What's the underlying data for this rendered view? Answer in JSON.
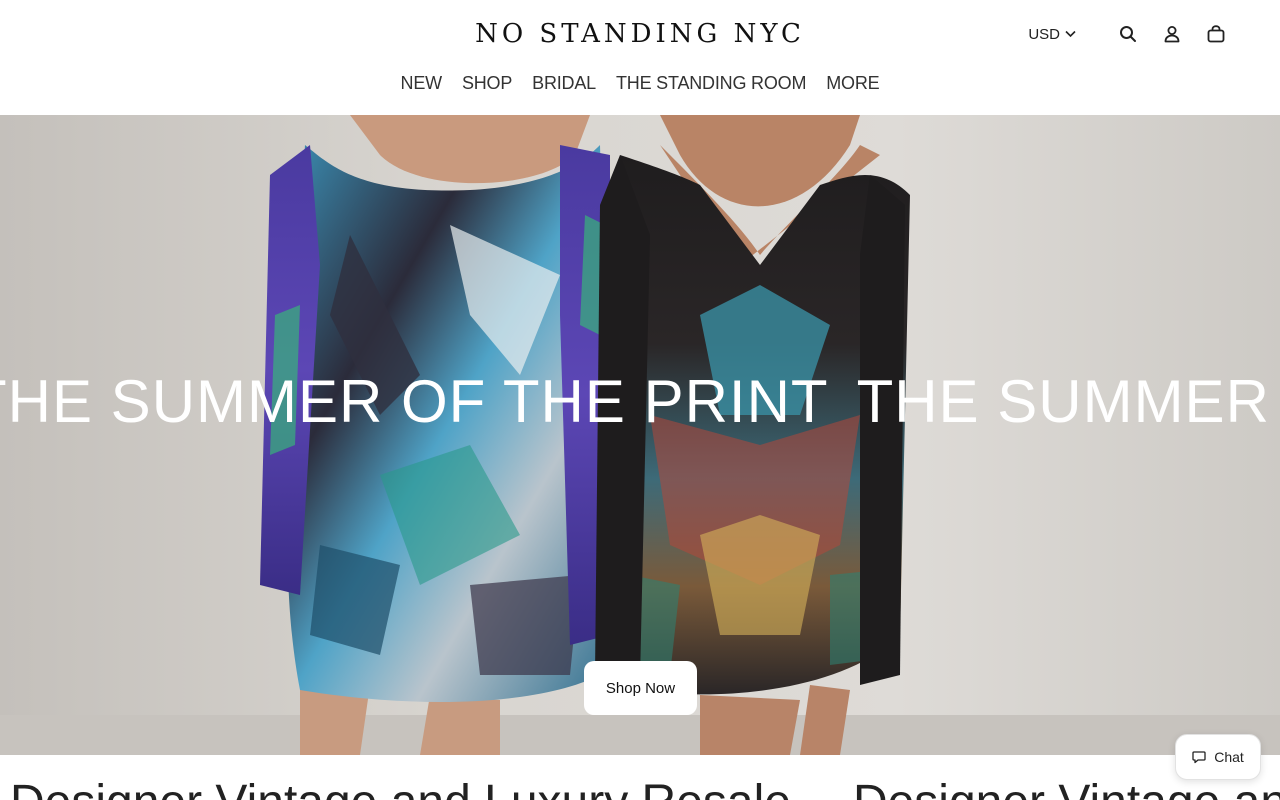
{
  "header": {
    "logo_text": "NO STANDING NYC",
    "currency": "USD",
    "icons": [
      "search-icon",
      "account-icon",
      "bag-icon"
    ]
  },
  "nav": {
    "items": [
      {
        "label": "NEW"
      },
      {
        "label": "SHOP"
      },
      {
        "label": "BRIDAL"
      },
      {
        "label": "THE STANDING ROOM"
      },
      {
        "label": "MORE"
      }
    ]
  },
  "hero": {
    "marquee": [
      "THE SUMMER OF THE PRINT",
      "THE SUMMER OF THE PRINT"
    ],
    "cta_label": "Shop Now"
  },
  "section": {
    "marquee": [
      "Designer Vintage and Luxury Resale",
      "Designer Vintage and Luxury Resale"
    ]
  },
  "chat": {
    "label": "Chat"
  },
  "colors": {
    "background": "#ffffff",
    "text": "#222222",
    "hero_text": "#ffffff"
  }
}
